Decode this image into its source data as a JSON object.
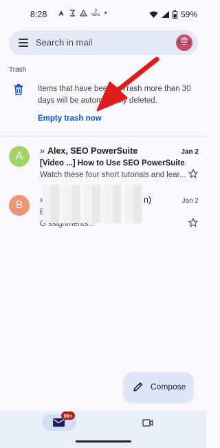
{
  "status_bar": {
    "time": "8:28",
    "net_speed_value": "0",
    "net_speed_unit": "KB/s",
    "dot": "•",
    "battery": "59%"
  },
  "search": {
    "placeholder": "Search in mail"
  },
  "trash": {
    "section_title": "Trash",
    "notice": "Items that have been in Trash more than 30 days will be automatically deleted.",
    "empty_link": "Empty trash now"
  },
  "emails": [
    {
      "avatar_letter": "A",
      "avatar_color": "#a5d36b",
      "marker": "»",
      "sender": "Alex, SEO PowerSuite",
      "date": "Jan 2",
      "subject": "[Video ...] How to Use SEO PowerSuite...",
      "snippet": "Watch these four short tutorials and lear...",
      "unread": true
    },
    {
      "avatar_letter": "B",
      "avatar_color": "#f09474",
      "marker": "»",
      "sender": "n)",
      "date": "Jan 2",
      "subject": "B re are your...",
      "snippet": "G ssignments...",
      "unread": false
    }
  ],
  "compose": {
    "label": "Compose"
  },
  "bottom_nav": {
    "mail_badge": "99+"
  },
  "colors": {
    "accent": "#0b57d0",
    "annotation_arrow": "#e01b1b",
    "badge": "#b3261e"
  }
}
